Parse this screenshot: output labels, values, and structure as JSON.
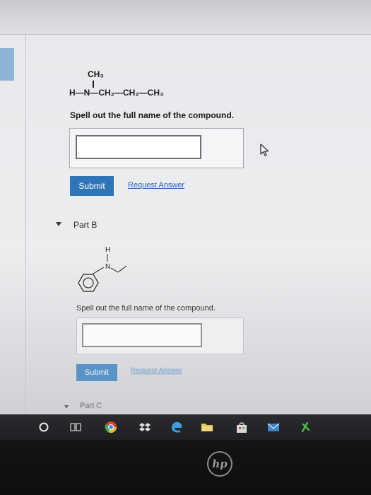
{
  "part_a": {
    "structure": {
      "top_group": "CH₃",
      "main_chain": "H—N—CH₂—CH₂—CH₃"
    },
    "prompt": "Spell out the full name of the compound.",
    "answer_value": "",
    "submit_label": "Submit",
    "request_answer_label": "Request Answer"
  },
  "part_b": {
    "label": "Part B",
    "structure": {
      "h_label": "H",
      "n_label": "N"
    },
    "prompt": "Spell out the full name of the compound.",
    "answer_value": "",
    "submit_label": "Submit",
    "request_answer_label": "Request Answer"
  },
  "part_c": {
    "label": "Part C"
  },
  "colors": {
    "submit_button": "#2f76b8",
    "link": "#2a66ad",
    "sidebar_highlight": "#8fb3d4"
  },
  "taskbar": {
    "icons": [
      "cortana-circle-icon",
      "task-view-icon",
      "chrome-icon",
      "dropbox-icon",
      "edge-icon",
      "file-explorer-icon",
      "store-icon",
      "mail-icon",
      "money-icon"
    ]
  },
  "device": {
    "logo": "hp"
  }
}
